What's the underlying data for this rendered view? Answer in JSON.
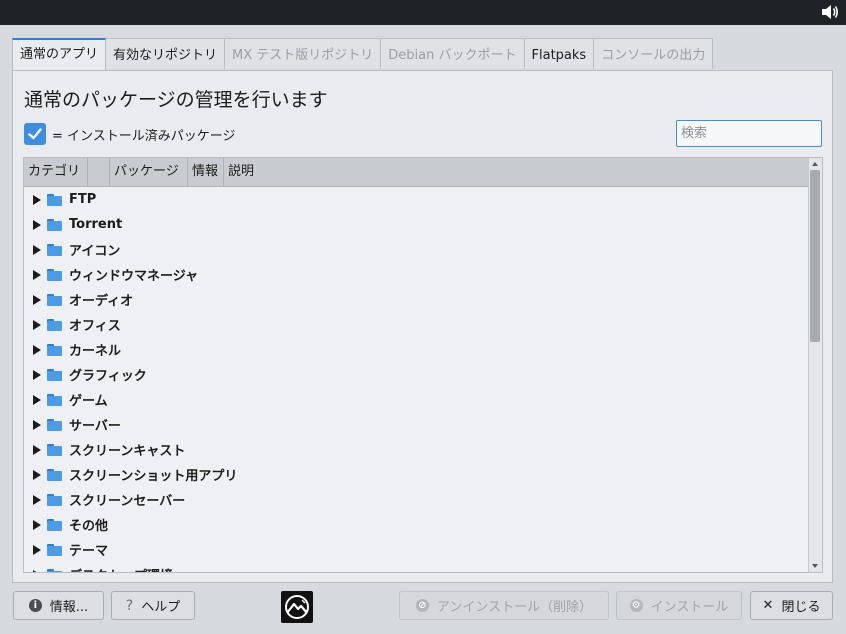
{
  "tabs": [
    {
      "label": "通常のアプリ",
      "state": "active"
    },
    {
      "label": "有効なリポジトリ",
      "state": "enabled"
    },
    {
      "label": "MX テスト版リポジトリ",
      "state": "disabled"
    },
    {
      "label": "Debian バックポート",
      "state": "disabled"
    },
    {
      "label": "Flatpaks",
      "state": "enabled"
    },
    {
      "label": "コンソールの出力",
      "state": "disabled"
    }
  ],
  "heading": "通常のパッケージの管理を行います",
  "legend": {
    "text": "= インストール済みパッケージ"
  },
  "search": {
    "placeholder": "検索",
    "value": ""
  },
  "columns": [
    "カテゴリ",
    "",
    "パッケージ",
    "情報",
    "説明"
  ],
  "categories": [
    "FTP",
    "Torrent",
    "アイコン",
    "ウィンドウマネージャ",
    "オーディオ",
    "オフィス",
    "カーネル",
    "グラフィック",
    "ゲーム",
    "サーバー",
    "スクリーンキャスト",
    "スクリーンショット用アプリ",
    "スクリーンセーバー",
    "その他",
    "テーマ",
    "デスクトップ環境"
  ],
  "buttons": {
    "about": "情報...",
    "help": "ヘルプ",
    "uninstall": "アンインストール（削除）",
    "install": "インストール",
    "close": "閉じる"
  },
  "colors": {
    "accent": "#2f7ed8",
    "checkbox": "#3d8ee0",
    "folder": "#4a9be8"
  }
}
